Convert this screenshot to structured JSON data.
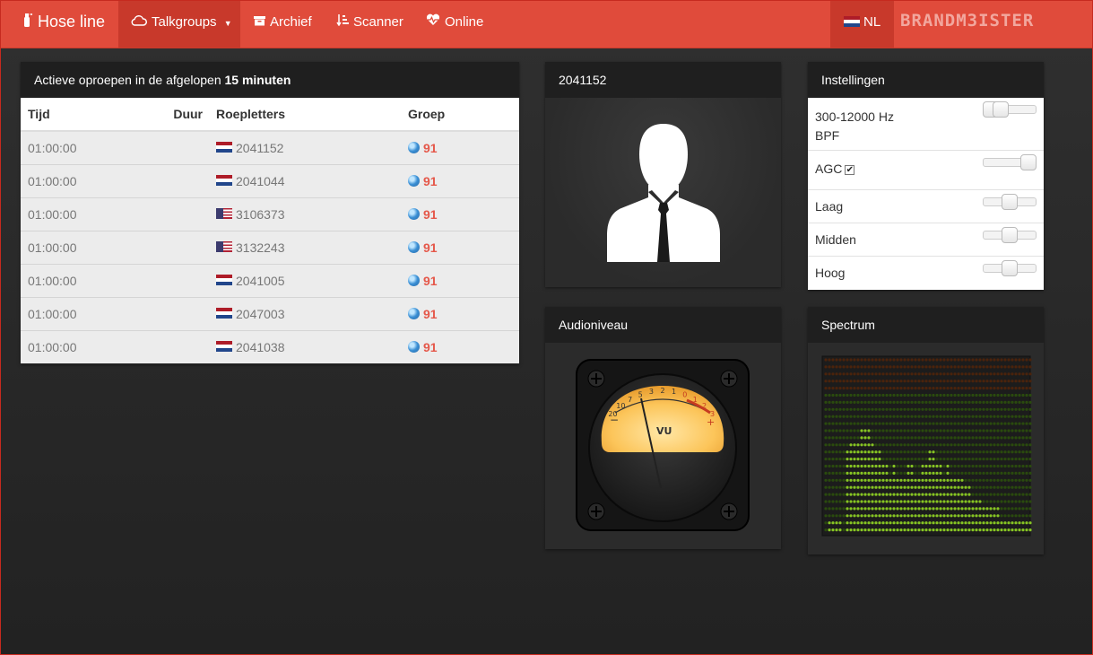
{
  "nav": {
    "brand": "Hose line",
    "talkgroups": "Talkgroups",
    "archief": "Archief",
    "scanner": "Scanner",
    "online": "Online",
    "language": "NL",
    "logo": "BRANDM3ISTER"
  },
  "calls_panel": {
    "title_prefix": "Actieve oproepen in de afgelopen",
    "title_bold": "15 minuten",
    "columns": {
      "tijd": "Tijd",
      "duur": "Duur",
      "roepletters": "Roepletters",
      "groep": "Groep"
    },
    "rows": [
      {
        "tijd": "01:00:00",
        "duur": "",
        "flag": "nl",
        "callsign": "2041152",
        "group": "91"
      },
      {
        "tijd": "01:00:00",
        "duur": "",
        "flag": "nl",
        "callsign": "2041044",
        "group": "91"
      },
      {
        "tijd": "01:00:00",
        "duur": "",
        "flag": "us",
        "callsign": "3106373",
        "group": "91"
      },
      {
        "tijd": "01:00:00",
        "duur": "",
        "flag": "us",
        "callsign": "3132243",
        "group": "91"
      },
      {
        "tijd": "01:00:00",
        "duur": "",
        "flag": "nl",
        "callsign": "2041005",
        "group": "91"
      },
      {
        "tijd": "01:00:00",
        "duur": "",
        "flag": "nl",
        "callsign": "2047003",
        "group": "91"
      },
      {
        "tijd": "01:00:00",
        "duur": "",
        "flag": "nl",
        "callsign": "2041038",
        "group": "91"
      }
    ]
  },
  "avatar_panel": {
    "title": "2041152"
  },
  "settings_panel": {
    "title": "Instellingen",
    "bpf_label_1": "300-12000 Hz",
    "bpf_label_2": "BPF",
    "bpf_range": [
      0.05,
      0.2
    ],
    "agc_label": "AGC",
    "agc_checked": true,
    "agc_level": 1.0,
    "laag_label": "Laag",
    "laag_level": 0.5,
    "midden_label": "Midden",
    "midden_level": 0.5,
    "hoog_label": "Hoog",
    "hoog_level": 0.5
  },
  "audio_panel": {
    "title": "Audioniveau",
    "vu_label": "VU",
    "scale": [
      "20",
      "10",
      "7",
      "5",
      "3",
      "2",
      "1",
      "0",
      "1",
      "2",
      "3"
    ],
    "minus": "−",
    "plus": "+"
  },
  "spectrum_panel": {
    "title": "Spectrum",
    "levels": [
      0,
      1,
      1,
      1,
      1,
      0,
      7,
      8,
      8,
      8,
      9,
      9,
      9,
      8,
      7,
      7,
      6,
      6,
      5,
      6,
      5,
      5,
      5,
      6,
      6,
      5,
      5,
      6,
      6,
      7,
      7,
      6,
      6,
      5,
      6,
      5,
      5,
      5,
      5,
      4,
      4,
      3,
      3,
      3,
      2,
      2,
      2,
      2,
      2,
      1,
      1,
      1,
      1,
      1,
      1,
      1,
      1,
      1
    ]
  },
  "colors": {
    "navbar": "#e04b3b",
    "navbar_active": "#c8392b",
    "accent_red": "#e5584a",
    "led_green": "#86c423",
    "led_dim": "#2a4a0e"
  }
}
